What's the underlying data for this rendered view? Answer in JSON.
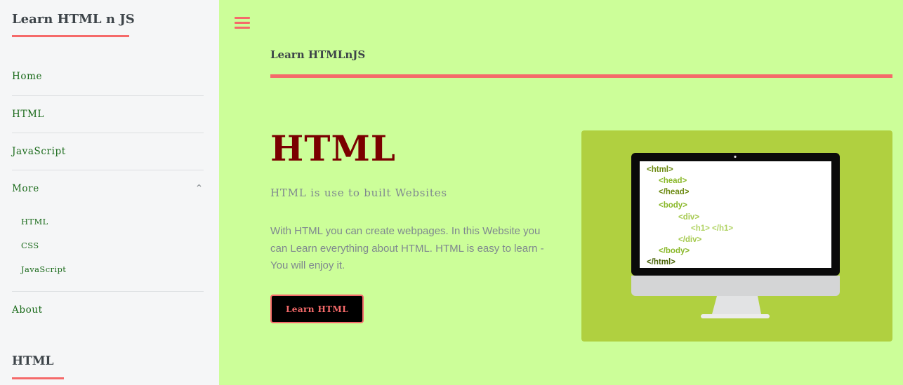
{
  "sidebar": {
    "brand": "Learn HTML n JS",
    "nav": {
      "home": "Home",
      "html": "HTML",
      "javascript": "JavaScript",
      "more": "More",
      "more_items": [
        "HTML",
        "CSS",
        "JavaScript"
      ],
      "about": "About"
    },
    "section_heading": "HTML"
  },
  "header": {
    "menu_icon": "hamburger-icon",
    "title": "Learn HTMLnJS"
  },
  "hero": {
    "title": "HTML",
    "subtitle": "HTML is use to built Websites",
    "body": "With HTML you can create webpages. In this Website you can Learn everything about HTML. HTML is easy to learn - You will enjoy it.",
    "button": "Learn HTML"
  },
  "illustration": {
    "code_lines": [
      "<html>",
      "<head>",
      "</head>",
      "<body>",
      "<div>",
      "<h1> </h1>",
      "</div>",
      "</body>",
      "</html>"
    ]
  },
  "colors": {
    "accent": "#f56a6a",
    "background": "#ccfe99",
    "sidebar": "#f5f6f7",
    "link": "#1a6a1a",
    "hero_title": "#7a0000",
    "illustration_bg": "#b0d040"
  }
}
